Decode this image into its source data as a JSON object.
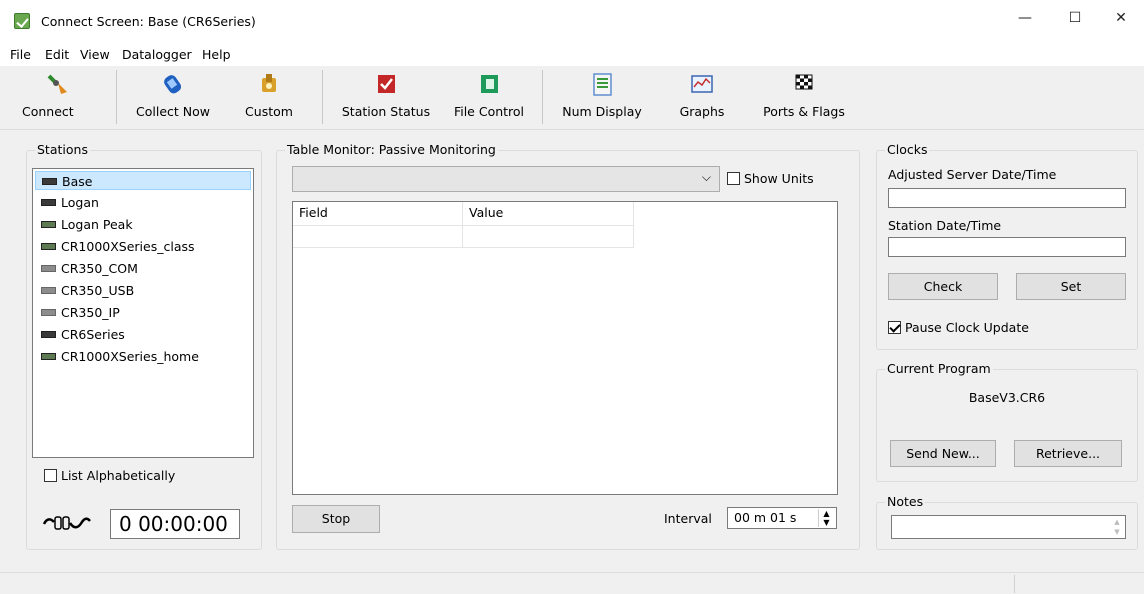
{
  "window": {
    "title": "Connect Screen: Base (CR6Series)",
    "min": "—",
    "max": "☐",
    "close": "✕"
  },
  "menu": [
    "File",
    "Edit",
    "View",
    "Datalogger",
    "Help"
  ],
  "toolbar": {
    "connect": "Connect",
    "collect_now": "Collect Now",
    "custom": "Custom",
    "station_status": "Station Status",
    "file_control": "File Control",
    "num_display": "Num Display",
    "graphs": "Graphs",
    "ports_flags": "Ports & Flags"
  },
  "stations": {
    "title": "Stations",
    "items": [
      {
        "label": "Base",
        "selected": true
      },
      {
        "label": "Logan"
      },
      {
        "label": "Logan Peak"
      },
      {
        "label": "CR1000XSeries_class"
      },
      {
        "label": "CR350_COM"
      },
      {
        "label": "CR350_USB"
      },
      {
        "label": "CR350_IP"
      },
      {
        "label": "CR6Series"
      },
      {
        "label": "CR1000XSeries_home"
      }
    ],
    "list_alpha": "List Alphabetically",
    "timer": "0 00:00:00"
  },
  "monitor": {
    "title": "Table Monitor: Passive Monitoring",
    "table_select_value": "",
    "show_units": "Show Units",
    "columns": [
      "Field",
      "Value"
    ],
    "stop": "Stop",
    "interval_label": "Interval",
    "interval_value": "00 m 01 s"
  },
  "clocks": {
    "title": "Clocks",
    "server_label": "Adjusted Server Date/Time",
    "server_value": "",
    "station_label": "Station Date/Time",
    "station_value": "",
    "check": "Check",
    "set": "Set",
    "pause": "Pause Clock Update",
    "pause_checked": true
  },
  "program": {
    "title": "Current Program",
    "name": "BaseV3.CR6",
    "send_new": "Send New...",
    "retrieve": "Retrieve..."
  },
  "notes": {
    "title": "Notes",
    "value": ""
  },
  "colors": {
    "selection": "#cce8ff",
    "background": "#f0f0f0",
    "button": "#e1e1e1"
  }
}
